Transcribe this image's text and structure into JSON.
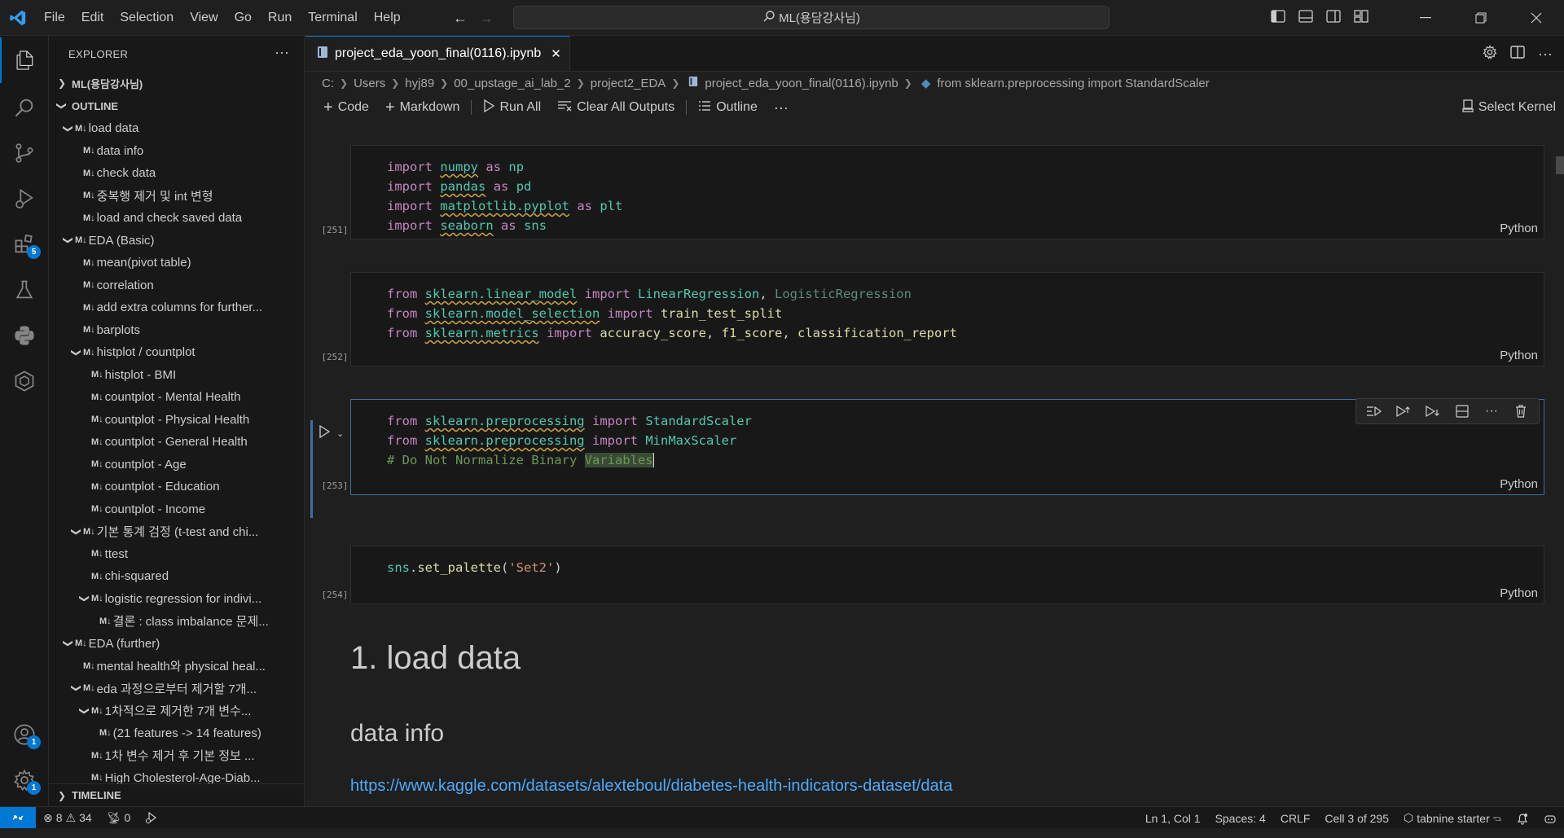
{
  "titlebar": {
    "menu": [
      "File",
      "Edit",
      "Selection",
      "View",
      "Go",
      "Run",
      "Terminal",
      "Help"
    ],
    "search": "ML(용담강사님)"
  },
  "activity_bar": {
    "extensions_badge": "5",
    "accounts_badge": "1",
    "settings_badge": "1"
  },
  "sidebar": {
    "title": "EXPLORER",
    "folder": "ML(용담강사님)",
    "outline_header": "OUTLINE",
    "timeline_header": "TIMELINE",
    "outline": [
      {
        "label": "load data",
        "level": 0,
        "chevron": true
      },
      {
        "label": "data info",
        "level": 1,
        "chevron": false
      },
      {
        "label": "check data",
        "level": 1,
        "chevron": false
      },
      {
        "label": "중복행 제거 및 int 변형",
        "level": 1,
        "chevron": false
      },
      {
        "label": "load and check saved data",
        "level": 1,
        "chevron": false
      },
      {
        "label": "EDA (Basic)",
        "level": 0,
        "chevron": true
      },
      {
        "label": "mean(pivot table)",
        "level": 1,
        "chevron": false
      },
      {
        "label": "correlation",
        "level": 1,
        "chevron": false
      },
      {
        "label": "add extra columns for further...",
        "level": 1,
        "chevron": false
      },
      {
        "label": "barplots",
        "level": 1,
        "chevron": false
      },
      {
        "label": "histplot / countplot",
        "level": 1,
        "chevron": true
      },
      {
        "label": "histplot - BMI",
        "level": 2,
        "chevron": false
      },
      {
        "label": "countplot - Mental Health",
        "level": 2,
        "chevron": false
      },
      {
        "label": "countplot - Physical Health",
        "level": 2,
        "chevron": false
      },
      {
        "label": "countplot - General Health",
        "level": 2,
        "chevron": false
      },
      {
        "label": "countplot - Age",
        "level": 2,
        "chevron": false
      },
      {
        "label": "countplot - Education",
        "level": 2,
        "chevron": false
      },
      {
        "label": "countplot - Income",
        "level": 2,
        "chevron": false
      },
      {
        "label": "기본 통계 검정 (t-test and chi...",
        "level": 1,
        "chevron": true
      },
      {
        "label": "ttest",
        "level": 2,
        "chevron": false
      },
      {
        "label": "chi-squared",
        "level": 2,
        "chevron": false
      },
      {
        "label": "logistic regression for indivi...",
        "level": 2,
        "chevron": true
      },
      {
        "label": "결론 : class imbalance 문제...",
        "level": 3,
        "chevron": false
      },
      {
        "label": "EDA (further)",
        "level": 0,
        "chevron": true
      },
      {
        "label": "mental health와 physical heal...",
        "level": 1,
        "chevron": false
      },
      {
        "label": "eda 과정으로부터 제거할 7개...",
        "level": 1,
        "chevron": true
      },
      {
        "label": "1차적으로 제거한 7개 변수...",
        "level": 2,
        "chevron": true
      },
      {
        "label": "(21 features -> 14 features)",
        "level": 3,
        "chevron": false
      },
      {
        "label": "1차 변수 제거 후 기본 정보 ...",
        "level": 2,
        "chevron": false
      },
      {
        "label": "High Cholesterol-Age-Diab...",
        "level": 2,
        "chevron": false
      }
    ]
  },
  "editor": {
    "tab_label": "project_eda_yoon_final(0116).ipynb",
    "breadcrumb": [
      "C:",
      "Users",
      "hyj89",
      "00_upstage_ai_lab_2",
      "project2_EDA",
      "project_eda_yoon_final(0116).ipynb",
      "from sklearn.preprocessing import StandardScaler"
    ],
    "toolbar": {
      "code": "Code",
      "markdown": "Markdown",
      "run_all": "Run All",
      "clear_all": "Clear All Outputs",
      "outline": "Outline",
      "select_kernel": "Select Kernel"
    },
    "cells": [
      {
        "count": "[251]",
        "lang": "Python"
      },
      {
        "count": "[252]",
        "lang": "Python"
      },
      {
        "count": "[253]",
        "lang": "Python"
      },
      {
        "count": "[254]",
        "lang": "Python"
      }
    ],
    "markdown": {
      "h1": "1. load data",
      "h2": "data info",
      "link": "https://www.kaggle.com/datasets/alexteboul/diabetes-health-indicators-dataset/data"
    }
  },
  "statusbar": {
    "errors": "8",
    "warnings": "34",
    "ports": "0",
    "position": "Ln 1, Col 1",
    "spaces": "Spaces: 4",
    "eol": "CRLF",
    "cell": "Cell 3 of 295",
    "tabnine": "tabnine starter"
  },
  "colors": {
    "accent": "#0078d4",
    "keyword": "#c586c0",
    "class": "#4ec9b0",
    "link": "#4daafc"
  }
}
